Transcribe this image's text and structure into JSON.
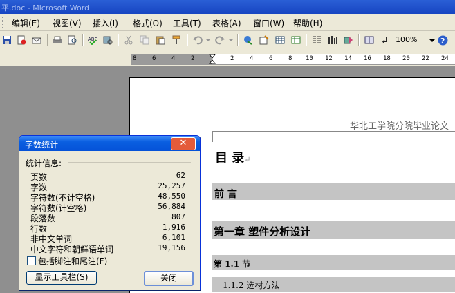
{
  "window": {
    "title": "平.doc - Microsoft Word"
  },
  "menu": [
    "编辑(E)",
    "视图(V)",
    "插入(I)",
    "格式(O)",
    "工具(T)",
    "表格(A)",
    "窗口(W)",
    "帮助(H)"
  ],
  "toolbar": {
    "zoom": "100%"
  },
  "ruler": {
    "ticks": [
      "8",
      "6",
      "4",
      "2",
      "2",
      "4",
      "6",
      "8",
      "10",
      "12",
      "14",
      "16",
      "18",
      "20",
      "22",
      "24"
    ]
  },
  "document": {
    "header": "华北工学院分院毕业论文",
    "toc_title": "目    录",
    "headings": [
      "前    言",
      "第一章  塑件分析设计",
      "第 1.1 节",
      "1.1.2 选材方法"
    ]
  },
  "dialog": {
    "title": "字数统计",
    "section_label": "统计信息:",
    "stats": [
      {
        "label": "页数",
        "value": "62"
      },
      {
        "label": "字数",
        "value": "25,257"
      },
      {
        "label": "字符数(不计空格)",
        "value": "48,550"
      },
      {
        "label": "字符数(计空格)",
        "value": "56,884"
      },
      {
        "label": "段落数",
        "value": "807"
      },
      {
        "label": "行数",
        "value": "1,916"
      },
      {
        "label": "非中文单词",
        "value": "6,101"
      },
      {
        "label": "中文字符和朝鲜语单词",
        "value": "19,156"
      }
    ],
    "checkbox_label": "包括脚注和尾注(F)",
    "toolbar_button": "显示工具栏(S)",
    "close_button": "关闭"
  }
}
